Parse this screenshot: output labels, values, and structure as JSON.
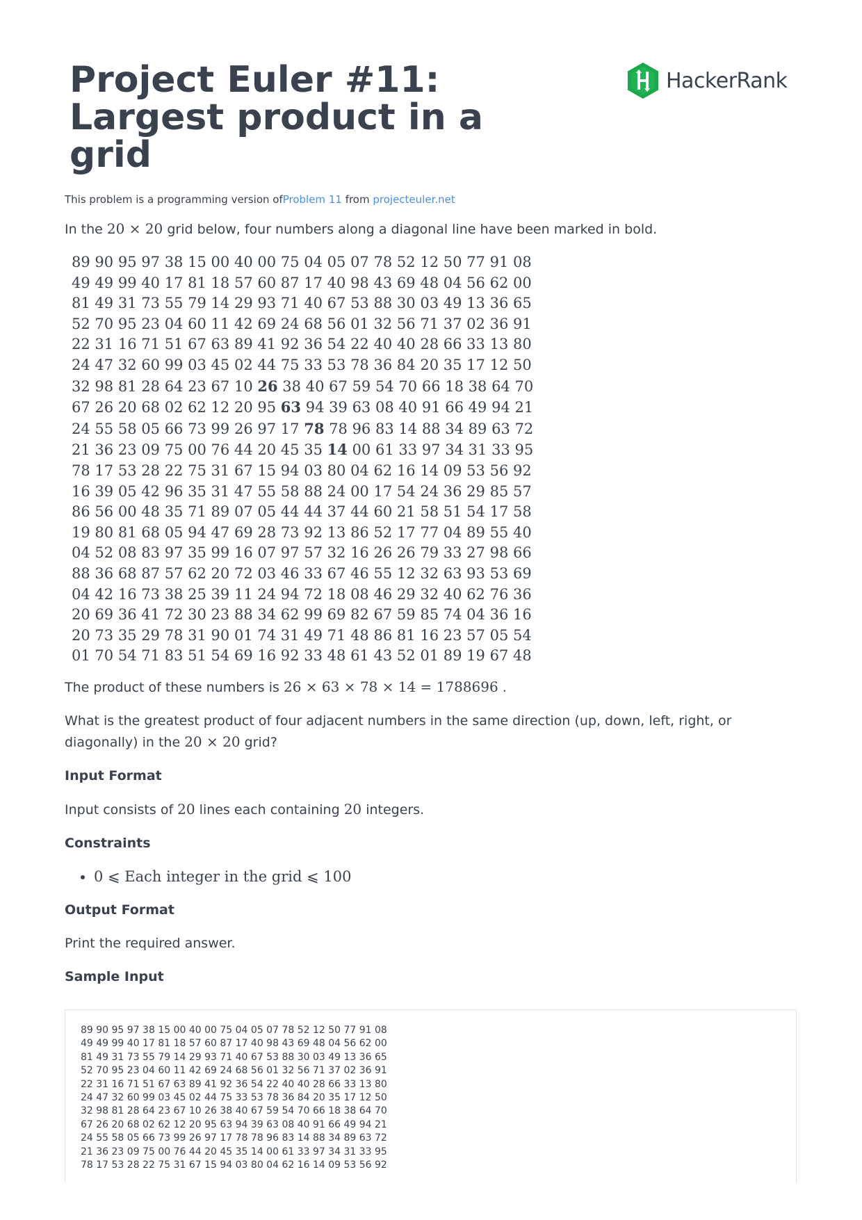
{
  "title": "Project Euler #11: Largest product in a grid",
  "logo_text": "HackerRank",
  "subtitle": {
    "prefix": "This problem is a programming version of",
    "link1": "Problem 11",
    "mid": " from ",
    "link2": "projecteuler.net"
  },
  "intro": {
    "before": "In the ",
    "math": "20 × 20",
    "after": " grid below, four numbers along a diagonal line have been marked in bold."
  },
  "grid": [
    "89 90 95 97 38 15 00 40 00 75 04 05 07 78 52 12 50 77 91 08",
    "49 49 99 40 17 81 18 57 60 87 17 40 98 43 69 48 04 56 62 00",
    "81 49 31 73 55 79 14 29 93 71 40 67 53 88 30 03 49 13 36 65",
    "52 70 95 23 04 60 11 42 69 24 68 56 01 32 56 71 37 02 36 91",
    "22 31 16 71 51 67 63 89 41 92 36 54 22 40 40 28 66 33 13 80",
    "24 47 32 60 99 03 45 02 44 75 33 53 78 36 84 20 35 17 12 50",
    "32 98 81 28 64 23 67 10 26 38 40 67 59 54 70 66 18 38 64 70",
    "67 26 20 68 02 62 12 20 95 63 94 39 63 08 40 91 66 49 94 21",
    "24 55 58 05 66 73 99 26 97 17 78 78 96 83 14 88 34 89 63 72",
    "21 36 23 09 75 00 76 44 20 45 35 14 00 61 33 97 34 31 33 95",
    "78 17 53 28 22 75 31 67 15 94 03 80 04 62 16 14 09 53 56 92",
    "16 39 05 42 96 35 31 47 55 58 88 24 00 17 54 24 36 29 85 57",
    "86 56 00 48 35 71 89 07 05 44 44 37 44 60 21 58 51 54 17 58",
    "19 80 81 68 05 94 47 69 28 73 92 13 86 52 17 77 04 89 55 40",
    "04 52 08 83 97 35 99 16 07 97 57 32 16 26 26 79 33 27 98 66",
    "88 36 68 87 57 62 20 72 03 46 33 67 46 55 12 32 63 93 53 69",
    "04 42 16 73 38 25 39 11 24 94 72 18 08 46 29 32 40 62 76 36",
    "20 69 36 41 72 30 23 88 34 62 99 69 82 67 59 85 74 04 36 16",
    "20 73 35 29 78 31 90 01 74 31 49 71 48 86 81 16 23 57 05 54",
    "01 70 54 71 83 51 54 69 16 92 33 48 61 43 52 01 89 19 67 48"
  ],
  "bold_cells": [
    {
      "row": 6,
      "col": 8
    },
    {
      "row": 7,
      "col": 9
    },
    {
      "row": 8,
      "col": 10
    },
    {
      "row": 9,
      "col": 11
    }
  ],
  "product_line": {
    "before": "The product of these numbers is ",
    "math": "26 × 63 × 78 × 14 = 1788696",
    "after": " ."
  },
  "question": {
    "before": "What is the greatest product of four adjacent numbers in the same direction (up, down, left, right, or diagonally) in the ",
    "math": "20 × 20",
    "after": " grid?"
  },
  "input_format": {
    "heading": "Input Format",
    "before": "Input consists of ",
    "math1": "20",
    "mid": " lines each containing ",
    "math2": "20",
    "after": " integers."
  },
  "constraints": {
    "heading": "Constraints",
    "item": "0 ⩽ Each integer in the grid ⩽ 100"
  },
  "output_format": {
    "heading": "Output Format",
    "text": "Print the required answer."
  },
  "sample_input": {
    "heading": "Sample Input",
    "rows": [
      "89 90 95 97 38 15 00 40 00 75 04 05 07 78 52 12 50 77 91 08",
      "49 49 99 40 17 81 18 57 60 87 17 40 98 43 69 48 04 56 62 00",
      "81 49 31 73 55 79 14 29 93 71 40 67 53 88 30 03 49 13 36 65",
      "52 70 95 23 04 60 11 42 69 24 68 56 01 32 56 71 37 02 36 91",
      "22 31 16 71 51 67 63 89 41 92 36 54 22 40 40 28 66 33 13 80",
      "24 47 32 60 99 03 45 02 44 75 33 53 78 36 84 20 35 17 12 50",
      "32 98 81 28 64 23 67 10 26 38 40 67 59 54 70 66 18 38 64 70",
      "67 26 20 68 02 62 12 20 95 63 94 39 63 08 40 91 66 49 94 21",
      "24 55 58 05 66 73 99 26 97 17 78 78 96 83 14 88 34 89 63 72",
      "21 36 23 09 75 00 76 44 20 45 35 14 00 61 33 97 34 31 33 95",
      "78 17 53 28 22 75 31 67 15 94 03 80 04 62 16 14 09 53 56 92"
    ]
  },
  "colors": {
    "text": "#39424e",
    "link": "#4a90e2",
    "logo_green": "#1ba94c"
  }
}
